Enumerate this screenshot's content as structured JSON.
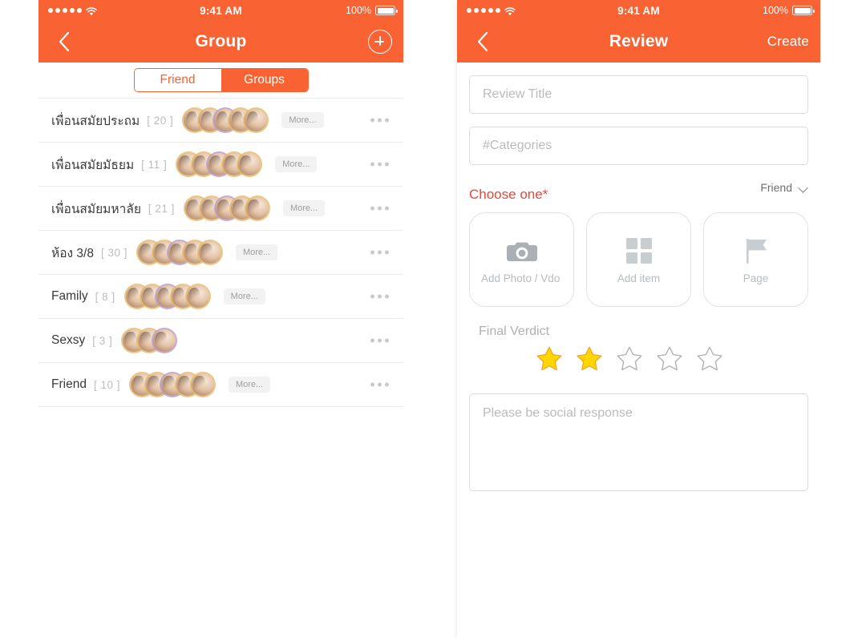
{
  "screens": {
    "group": {
      "status_bar": {
        "signal_dots": 5,
        "wifi_icon": "wifi-icon",
        "time": "9:41 AM",
        "battery_percent": "100%",
        "battery_icon": "battery-full-icon"
      },
      "navbar": {
        "back_icon": "chevron-left-icon",
        "title": "Group",
        "add_icon": "plus-circle-icon"
      },
      "tabs": [
        {
          "label": "Friend",
          "active": false
        },
        {
          "label": "Groups",
          "active": true
        }
      ],
      "rows": [
        {
          "name": "เพื่อนสมัยประถม",
          "count": "[ 20 ]",
          "avatars": 5,
          "more_label": "More...",
          "menu_icon": "more-horizontal-icon"
        },
        {
          "name": "เพื่อนสมัยมัธยม",
          "count": "[ 11 ]",
          "avatars": 5,
          "more_label": "More...",
          "menu_icon": "more-horizontal-icon"
        },
        {
          "name": "เพื่อนสมัยมหาลัย",
          "count": "[ 21 ]",
          "avatars": 5,
          "more_label": "More...",
          "menu_icon": "more-horizontal-icon"
        },
        {
          "name": "ห้อง 3/8",
          "count": "[ 30 ]",
          "avatars": 5,
          "more_label": "More...",
          "menu_icon": "more-horizontal-icon"
        },
        {
          "name": "Family",
          "count": "[ 8 ]",
          "avatars": 5,
          "more_label": "More...",
          "menu_icon": "more-horizontal-icon"
        },
        {
          "name": "Sexsy",
          "count": "[ 3 ]",
          "avatars": 3,
          "more_label": "",
          "menu_icon": "more-horizontal-icon"
        },
        {
          "name": "Friend",
          "count": "[ 10 ]",
          "avatars": 5,
          "more_label": "More...",
          "menu_icon": "more-horizontal-icon"
        }
      ]
    },
    "review": {
      "status_bar": {
        "signal_dots": 5,
        "wifi_icon": "wifi-icon",
        "time": "9:41 AM",
        "battery_percent": "100%",
        "battery_icon": "battery-full-icon"
      },
      "navbar": {
        "back_icon": "chevron-left-icon",
        "title": "Review",
        "action_label": "Create"
      },
      "form": {
        "title_placeholder": "Review Title",
        "title_value": "",
        "categories_placeholder": "#Categories",
        "categories_value": "",
        "choose_label": "Choose one*",
        "audience_value": "Friend",
        "audience_chevron_icon": "chevron-down-icon",
        "cards": [
          {
            "label": "Add Photo / Vdo",
            "icon": "camera-icon"
          },
          {
            "label": "Add item",
            "icon": "grid-icon"
          },
          {
            "label": "Page",
            "icon": "flag-icon"
          }
        ],
        "verdict_label": "Final Verdict",
        "rating": 2,
        "rating_max": 5,
        "response_placeholder": "Please be social response",
        "response_value": ""
      }
    }
  },
  "colors": {
    "brand_orange": "#F96232",
    "required_red": "#E8453C",
    "star_filled": "#FFD600",
    "star_empty_outline": "#AFAFAF",
    "placeholder_gray": "#BBBBBB",
    "border_gray": "#DCDCDC"
  }
}
